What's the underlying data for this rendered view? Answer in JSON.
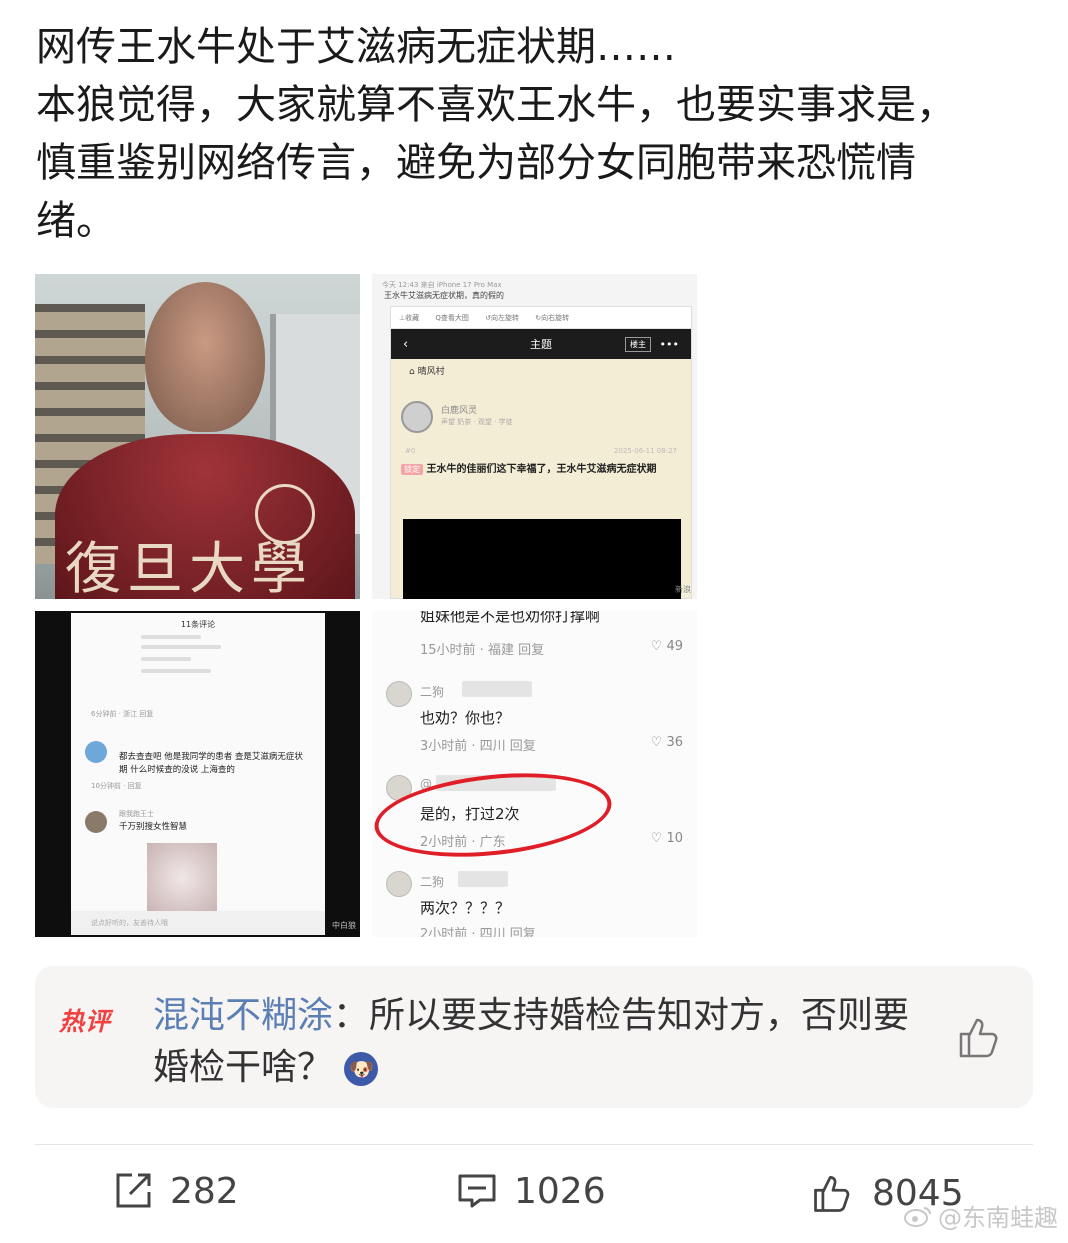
{
  "post": {
    "lines": [
      "网传王水牛处于艾滋病无症状期……",
      "本狼觉得，大家就算不喜欢王水牛，也要实事求是，",
      "慎重鉴别网络传言，避免为部分女同胞带来恐慌情",
      "绪。"
    ]
  },
  "images": {
    "img1": {
      "shirt_text": "復旦大學"
    },
    "img2": {
      "meta": "今天 12:43 来自 iPhone 17 Pro Max",
      "caption": "王水牛艾滋病无症状期，真的假的",
      "toolbar": [
        "⊥收藏",
        "Q查看大图",
        "↺向左旋转",
        "↻向右旋转"
      ],
      "header_title": "主题",
      "header_badge": "楼主",
      "board": "晴风村",
      "user_name": "白鹿风灵",
      "user_role": "声望 奶茶 · 观望 · 学徒",
      "floor": "#0",
      "date": "2025-06-11 08:27",
      "lock_tag": "锁定",
      "body": "王水牛的佳丽们这下幸福了，王水牛艾滋病无症状期",
      "watermark": "新浪"
    },
    "img3": {
      "title": "11条评论",
      "meta1": "6分钟前 · 浙江    回复",
      "comment": "都去查查吧 他是我同学的患者 查是艾滋病无症状期 什么时候查的没说 上海查的",
      "meta2": "10分钟前 · 回复",
      "user2": "跟我跑王士",
      "comment2": "千万别搜女性智慧",
      "input_placeholder": "说点好听的，友善待人哦",
      "watermark": "中白狼"
    },
    "img4": {
      "top_line": "姐妹他是不是也劝你打撑啊",
      "top_meta": "15小时前 · 福建    回复",
      "top_likes": "49",
      "u1": "二狗",
      "c1": "也劝？你也？",
      "m1": "3小时前 · 四川    回复",
      "l1": "36",
      "u2": "@",
      "c2": "是的，打过2次",
      "m2": "2小时前 · 广东",
      "l2": "10",
      "u3": "二狗",
      "c3": "两次？？？？",
      "m3": "2小时前 · 四川    回复"
    }
  },
  "hot_comment": {
    "tag": "热评",
    "user": "混沌不糊涂",
    "sep": "：",
    "text": "所以要支持婚检告知对方，否则要婚检干啥？",
    "emoji": "🐶"
  },
  "actions": {
    "repost": "282",
    "comment": "1026",
    "like": "8045"
  },
  "watermark": "@东南蛙趣"
}
